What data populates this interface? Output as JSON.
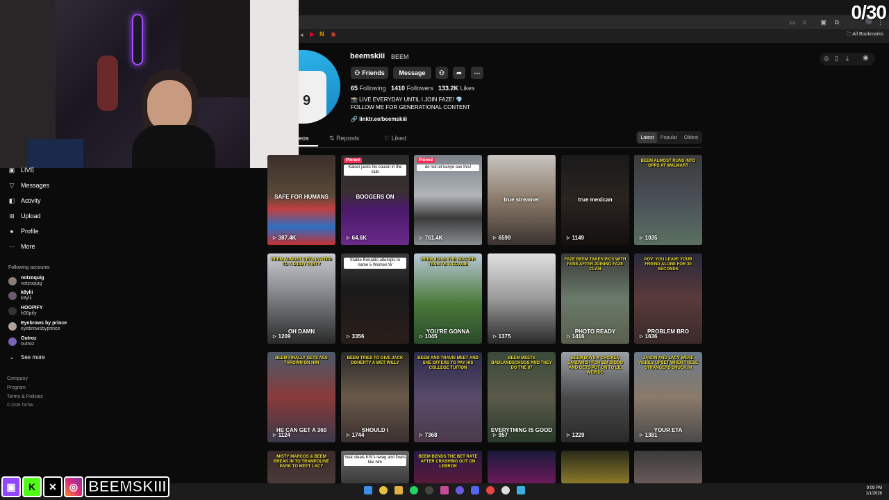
{
  "stream": {
    "counter": "0/30",
    "brand_text": "BEEMSKIII"
  },
  "browser": {
    "all_bookmarks": "All Bookmarks"
  },
  "sidebar": {
    "items": [
      {
        "label": "LIVE",
        "icon": "live-icon"
      },
      {
        "label": "Messages",
        "icon": "send-icon"
      },
      {
        "label": "Activity",
        "icon": "bell-icon"
      },
      {
        "label": "Upload",
        "icon": "plus-icon"
      },
      {
        "label": "Profile",
        "icon": "person-icon"
      },
      {
        "label": "More",
        "icon": "dots-icon"
      }
    ],
    "following_title": "Following accounts",
    "accounts": [
      {
        "name": "notzoquig",
        "handle": "notzoquig",
        "color": "#8a7f73"
      },
      {
        "name": "k8ylii",
        "handle": "k8ylii",
        "color": "#6b5a6e"
      },
      {
        "name": "HOOPIFY",
        "handle": "h00pify",
        "color": "#333333"
      },
      {
        "name": "Eyebrows by prince",
        "handle": "eyebrowsbyprince",
        "color": "#b0a49a"
      },
      {
        "name": "Outroz",
        "handle": "outroz",
        "color": "#7a63b8"
      }
    ],
    "see_more": "See more",
    "footer": [
      "Company",
      "Program",
      "Terms & Policies",
      "© 2026 TikTok"
    ]
  },
  "profile": {
    "username": "beemskiii",
    "display_name": "BEEM",
    "friends_label": "Friends",
    "message_label": "Message",
    "following_count": "65",
    "following_label": "Following",
    "followers_count": "1410",
    "followers_label": "Followers",
    "likes_count": "133.2K",
    "likes_label": "Likes",
    "bio_line1": "📸 LIVE EVERYDAY UNTIL I JOIN FAZE! 💎",
    "bio_line2": "FOLLOW ME FOR GENERATIONAL CONTENT",
    "link": "linktr.ee/beemskiii"
  },
  "tabs": {
    "videos": "eos",
    "reposts": "Reposts",
    "liked": "Liked"
  },
  "sort": {
    "latest": "Latest",
    "popular": "Popular",
    "oldest": "Oldest"
  },
  "pinned_label": "Pinned",
  "videos": [
    {
      "views": "387.4K",
      "overlay": "SAFE FOR HUMANS",
      "bg": "linear-gradient(180deg,#3a2f2a 0%,#5a4a3a 45%,#c04040 60%,#2e6fc2 80%,#c83030 100%)"
    },
    {
      "views": "64.6K",
      "pinned": true,
      "caption": "Kaiser jacks his cousin in the club",
      "overlay": "BOOGERS ON",
      "bg": "linear-gradient(180deg,#2a2a2a 0%,#3a3030 40%,#4a1a6a 60%,#6a2a8a 100%)"
    },
    {
      "views": "761.4K",
      "pinned": true,
      "caption": "do not let kanye see this!",
      "bg": "linear-gradient(180deg,#7a8088 0%,#b0b4b8 45%,#3a3a3a 70%,#8a8e92 100%)"
    },
    {
      "views": "6599",
      "overlay": "true streamer",
      "bg": "linear-gradient(180deg,#c8c4c0 0%,#8a7a6a 50%,#3a3230 100%)"
    },
    {
      "views": "1149",
      "overlay": "true mexican",
      "bg": "linear-gradient(180deg,#1a1a1a 0%,#2a2420 50%,#14100e 100%)"
    },
    {
      "views": "1035",
      "caption": "BEEM ALMOST RUNS INTO OPPS AT WALMART",
      "bg": "linear-gradient(180deg,#3a3a3a 0%,#4a5058 50%,#5a7060 100%)"
    },
    {
      "views": "1209",
      "caption": "BEEM ALMOST GETS INVITED TO A DIDDY PARTY",
      "overlay": "OH DAMN",
      "bg": "linear-gradient(180deg,#c8ccd0 0%,#8a8e92 40%,#2a2a2a 100%)"
    },
    {
      "views": "3356",
      "caption": "Stable Ronaldo attempts to name 5 Women W",
      "bg": "linear-gradient(180deg,#3a3a3a 0%,#1a1a1a 40%,#2a1e1a 100%)"
    },
    {
      "views": "1045",
      "caption": "BEEM JOINS THE SOCCER TEAM AS A GOALIE",
      "overlay": "YOU'RE GONNA",
      "bg": "linear-gradient(180deg,#b8c8d8 0%,#4a7a3a 55%,#2a4a2a 100%)"
    },
    {
      "views": "1375",
      "bg": "linear-gradient(180deg,#e0e0e0 0%,#9a9a9a 50%,#2a2a2a 100%)"
    },
    {
      "views": "1416",
      "caption": "FAZE BEEM TAKES PICS WITH FANS AFTER JOINING FAZE CLAN",
      "overlay": "PHOTO READY",
      "bg": "linear-gradient(180deg,#3a3a3a 0%,#6a7a6a 50%,#5a6050 100%)"
    },
    {
      "views": "1636",
      "caption": "POV: YOU LEAVE YOUR FRIEND ALONE FOR 30 SECONDS",
      "overlay": "PROBLEM BRO",
      "bg": "linear-gradient(180deg,#2a2a3a 0%,#5a3a3a 50%,#3a2a2a 100%)"
    },
    {
      "views": "1124",
      "caption": "BEEM FINALLY GETS ASS THROWN ON HIM",
      "overlay": "HE CAN GET A 360",
      "bg": "linear-gradient(180deg,#4a5a6a 0%,#8a3a3a 50%,#3a3a4a 100%)"
    },
    {
      "views": "1744",
      "caption": "BEEM TRIES TO GIVE JACK DOHERTY A WET WILLY",
      "overlay": "SHOULD I",
      "bg": "linear-gradient(180deg,#2a2a2a 0%,#6a5a4a 50%,#3a3030 100%)"
    },
    {
      "views": "7368",
      "caption": "BEEM AND TRAVIS MEET AND SHE OFFERS TO PAY HIS COLLEGE TUITION",
      "bg": "linear-gradient(180deg,#2a2a4a 0%,#5a4a6a 50%,#4a3a4a 100%)"
    },
    {
      "views": "957",
      "caption": "BEEM MEETS BADLANDSCHUGS AND THEY DO THE 67",
      "overlay": "EVERYTHING IS GOOD",
      "bg": "linear-gradient(180deg,#3a4a3a 0%,#5a5a4a 50%,#2a3a2a 100%)"
    },
    {
      "views": "1229",
      "caption": "BEEM BUYS A CHICKEN SANDWICH FOR $24 DIDDO AND GETS PUT ON TO LIL WEIRDO",
      "bg": "linear-gradient(180deg,#9aa0a6 0%,#4a4a4a 50%,#2a2a2a 100%)"
    },
    {
      "views": "1381",
      "caption": "JASON AND LACY WERE VISIBLY UPSET WHEN THESE STRANGERS SNUCK IN",
      "overlay": "YOUR ETA",
      "bg": "linear-gradient(180deg,#6a7a8a 0%,#8a7a6a 50%,#4a4a4a 100%)"
    },
    {
      "caption": "MISTY MARCOS & BEEM BREAK IN TO TRAMPOLINE PARK TO MEET LACY",
      "bg": "linear-gradient(180deg,#3a2a2a 0%,#4a3a3a 100%)"
    },
    {
      "caption": "Yeat steals KSI's swag and floats like him",
      "bg": "linear-gradient(180deg,#6a6a6a 0%,#3a3a3a 100%)"
    },
    {
      "caption": "BEEM BENDS THE BET RATE AFTER CRASHING OUT ON LEBRON",
      "bg": "linear-gradient(180deg,#2a1a4a 0%,#5a1a3a 100%)"
    },
    {
      "bg": "linear-gradient(180deg,#1a1a3a 0%,#6a1a5a 100%)"
    },
    {
      "bg": "linear-gradient(180deg,#2a2a1a 0%,#8a7a2a 100%)"
    },
    {
      "bg": "linear-gradient(180deg,#3a3a3a 0%,#6a5a5a 100%)"
    }
  ],
  "taskbar": {
    "time": "9:09 PM",
    "date": "1/1/2026"
  }
}
